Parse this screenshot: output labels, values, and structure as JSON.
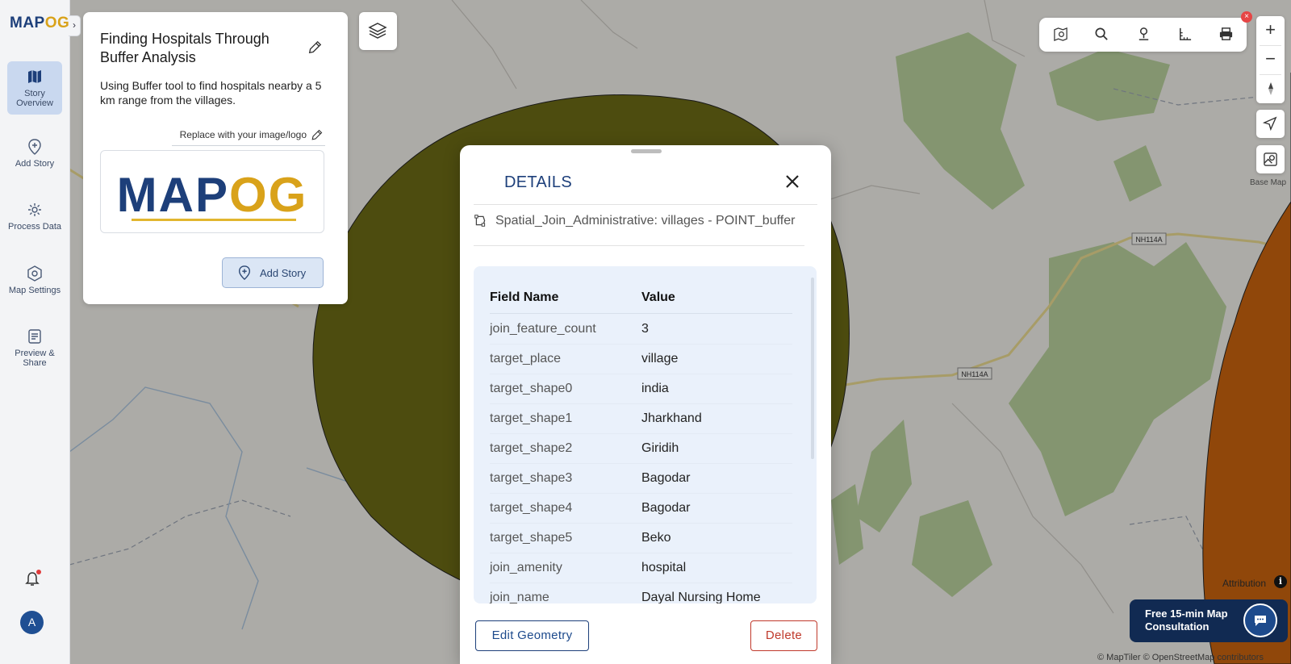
{
  "app": {
    "logo_prefix": "MAP",
    "logo_suffix": "OG",
    "collapse_glyph": "›"
  },
  "sidebar": {
    "items": [
      {
        "label": "Story Overview",
        "icon": "map-icon",
        "active": true
      },
      {
        "label": "Add Story",
        "icon": "map-pin-plus-icon",
        "active": false
      },
      {
        "label": "Process Data",
        "icon": "gear-icon",
        "active": false
      },
      {
        "label": "Map Settings",
        "icon": "settings-hex-icon",
        "active": false
      },
      {
        "label": "Preview & Share",
        "icon": "preview-icon",
        "active": false
      }
    ],
    "avatar_letter": "A"
  },
  "story_card": {
    "title": "Finding Hospitals Through Buffer Analysis",
    "description": "Using Buffer tool to find hospitals nearby a 5 km range from the villages.",
    "replace_label": "Replace with your image/logo",
    "logo_prefix": "MAP",
    "logo_suffix": "OG",
    "add_story_label": "Add Story"
  },
  "map": {
    "road_labels": [
      "NH114A",
      "NH114A"
    ],
    "basemap_label": "Base Map",
    "attribution_label": "Attribution",
    "attribution_icon": "i",
    "copyright": "© MapTiler © OpenStreetMap contributors",
    "consult_label": "Free 15-min Map Consultation",
    "colors": {
      "buffer_fill": "#6b6a15",
      "orange_polygon": "#c8630e",
      "forest": "#b7cf9c",
      "base": "#efede8"
    }
  },
  "toolbar": {
    "icons": [
      "map-search-icon",
      "search-icon",
      "pin-icon",
      "measure-icon",
      "print-icon"
    ],
    "close_glyph": "×",
    "zoom_in": "+",
    "zoom_out": "−"
  },
  "modal": {
    "title": "DETAILS",
    "layer_name": "Spatial_Join_Administrative: villages - POINT_buffer",
    "headers": {
      "field": "Field Name",
      "value": "Value"
    },
    "rows": [
      {
        "field": "join_feature_count",
        "value": "3"
      },
      {
        "field": "target_place",
        "value": "village"
      },
      {
        "field": "target_shape0",
        "value": "india"
      },
      {
        "field": "target_shape1",
        "value": "Jharkhand"
      },
      {
        "field": "target_shape2",
        "value": "Giridih"
      },
      {
        "field": "target_shape3",
        "value": "Bagodar"
      },
      {
        "field": "target_shape4",
        "value": "Bagodar"
      },
      {
        "field": "target_shape5",
        "value": "Beko"
      },
      {
        "field": "join_amenity",
        "value": "hospital"
      },
      {
        "field": "join_name",
        "value": "Dayal Nursing Home"
      }
    ],
    "edit_label": "Edit Geometry",
    "delete_label": "Delete"
  }
}
